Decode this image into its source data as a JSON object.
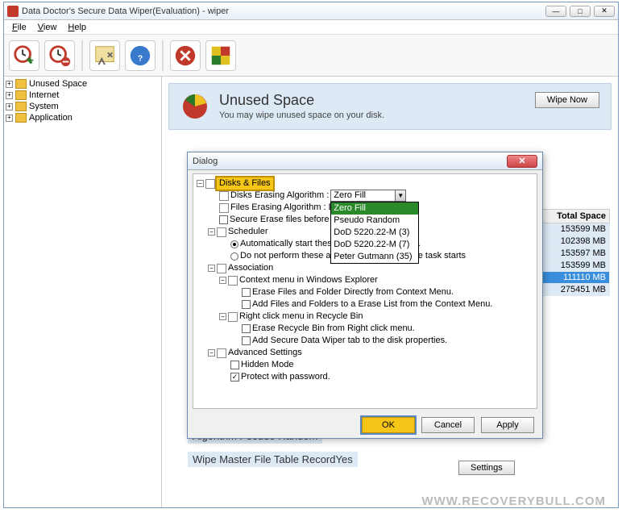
{
  "window": {
    "title": "Data Doctor's Secure Data Wiper(Evaluation) - wiper"
  },
  "menubar": {
    "items": [
      "File",
      "View",
      "Help"
    ]
  },
  "sidebar": {
    "items": [
      {
        "label": "Unused Space"
      },
      {
        "label": "Internet"
      },
      {
        "label": "System"
      },
      {
        "label": "Application"
      }
    ]
  },
  "header": {
    "title": "Unused Space",
    "subtitle": "You may wipe unused space on your disk.",
    "wipe_btn": "Wipe Now"
  },
  "table": {
    "header": "Total Space",
    "rows": [
      "153599 MB",
      "102398 MB",
      "153597 MB",
      "153599 MB",
      "111110 MB",
      "275451 MB"
    ],
    "selected_index": 4
  },
  "bottom": {
    "line1": "Algorithm Pseudo Random",
    "line2": "Wipe Master File Table RecordYes",
    "settings_btn": "Settings"
  },
  "watermark": "www.Recoverybull.com",
  "dialog": {
    "title": "Dialog",
    "root": "Disks & Files",
    "disks_erasing_label": "Disks Erasing Algorithm :",
    "disks_erasing_value": "Zero Fill",
    "files_erasing_label": "Files Erasing Algorithm : D",
    "secure_erase_label": "Secure Erase files before",
    "dropdown_options": [
      "Zero Fill",
      "Pseudo Random",
      "DoD 5220.22-M (3)",
      "DoD 5220.22-M (7)",
      "Peter Gutmann (35)"
    ],
    "dropdown_selected_index": 0,
    "scheduler": {
      "label": "Scheduler",
      "opt1": "Automatically start these a",
      "opt1_suffix": " startup.",
      "opt2": "Do not perform these actions when a schedule task starts"
    },
    "association": {
      "label": "Association",
      "context_menu": "Context menu in Windows Explorer",
      "cm1": "Erase Files and Folder Directly from Context Menu.",
      "cm2": "Add Files and Folders to a Erase List from the Context Menu.",
      "rightclick": "Right click menu in Recycle Bin",
      "rc1": "Erase Recycle Bin from Right click menu.",
      "rc2": "Add Secure Data Wiper tab to the disk properties."
    },
    "advanced": {
      "label": "Advanced Settings",
      "hidden": "Hidden Mode",
      "protect": "Protect with password."
    },
    "buttons": {
      "ok": "OK",
      "cancel": "Cancel",
      "apply": "Apply"
    }
  }
}
